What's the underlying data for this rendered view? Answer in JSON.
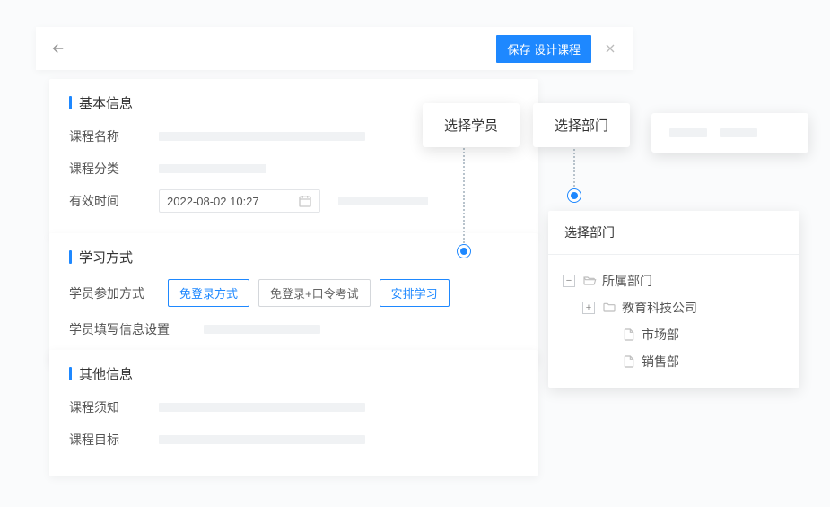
{
  "topbar": {
    "save_design_label": "保存 设计课程"
  },
  "sections": {
    "basic": {
      "title": "基本信息",
      "fields": {
        "course_name": "课程名称",
        "course_category": "课程分类",
        "valid_time": "有效时间",
        "valid_time_value": "2022-08-02 10:27"
      }
    },
    "study": {
      "title": "学习方式",
      "fields": {
        "participation": "学员参加方式",
        "student_info": "学员填写信息设置"
      },
      "options": {
        "login_free": "免登录方式",
        "login_free_exam": "免登录+口令考试",
        "arrange_study": "安排学习"
      }
    },
    "other": {
      "title": "其他信息",
      "fields": {
        "course_notice": "课程须知",
        "course_goal": "课程目标"
      }
    }
  },
  "popovers": {
    "select_student": "选择学员",
    "select_department": "选择部门"
  },
  "dept_panel": {
    "title": "选择部门",
    "tree": {
      "root": "所属部门",
      "child1": "教育科技公司",
      "leaf1": "市场部",
      "leaf2": "销售部"
    }
  }
}
